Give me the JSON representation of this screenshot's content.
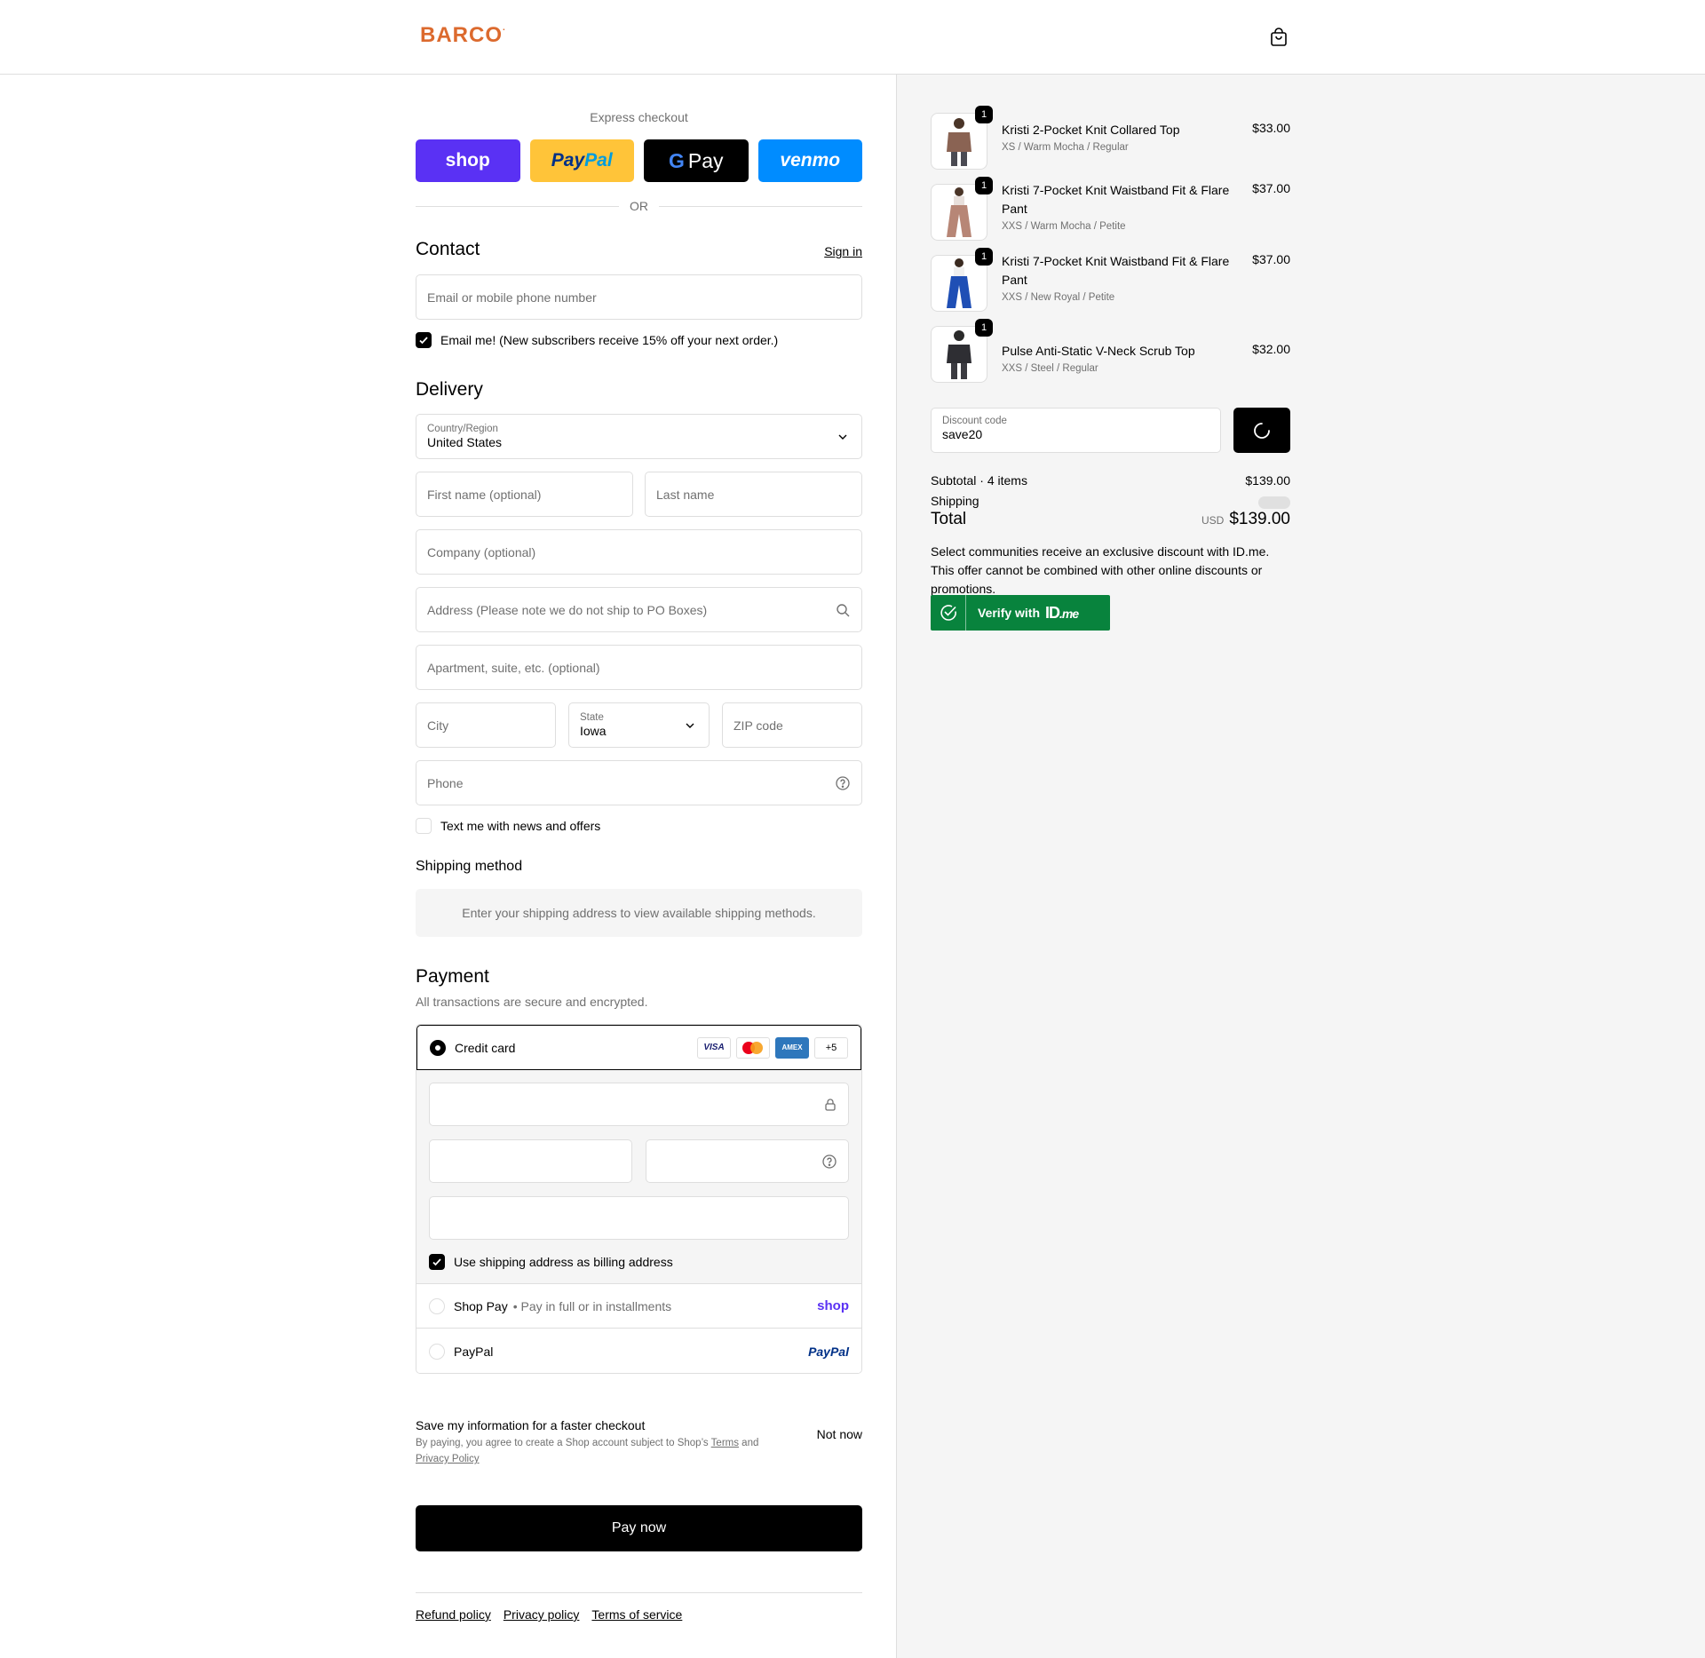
{
  "header": {
    "logo": "BARCO",
    "logo_mark": "."
  },
  "express": {
    "title": "Express checkout",
    "buttons": {
      "shop": "shop",
      "paypal_pay": "Pay",
      "paypal_pal": "Pal",
      "gpay_g": "G",
      "gpay_pay": "Pay",
      "venmo": "venmo"
    },
    "or": "OR"
  },
  "contact": {
    "heading": "Contact",
    "sign_in": "Sign in",
    "email_placeholder": "Email or mobile phone number",
    "email_me_label": "Email me! (New subscribers receive 15% off your next order.)",
    "email_me_checked": true
  },
  "delivery": {
    "heading": "Delivery",
    "country_label": "Country/Region",
    "country_value": "United States",
    "first_name_placeholder": "First name (optional)",
    "last_name_placeholder": "Last name",
    "company_placeholder": "Company (optional)",
    "address_placeholder": "Address (Please note we do not ship to PO Boxes)",
    "apartment_placeholder": "Apartment, suite, etc. (optional)",
    "city_placeholder": "City",
    "state_label": "State",
    "state_value": "Iowa",
    "zip_placeholder": "ZIP code",
    "phone_placeholder": "Phone",
    "text_me_label": "Text me with news and offers",
    "text_me_checked": false
  },
  "shipping_method": {
    "heading": "Shipping method",
    "message": "Enter your shipping address to view available shipping methods."
  },
  "payment": {
    "heading": "Payment",
    "subtitle": "All transactions are secure and encrypted.",
    "credit_card_label": "Credit card",
    "card_logos": {
      "visa": "VISA",
      "amex": "AMEX",
      "more": "+5"
    },
    "billing_same_label": "Use shipping address as billing address",
    "billing_same_checked": true,
    "shop_pay_label": "Shop Pay",
    "shop_pay_sub": "Pay in full or in installments",
    "shop_pay_brand": "shop",
    "paypal_label": "PayPal",
    "paypal_brand": "PayPal"
  },
  "save_info": {
    "title": "Save my information for a faster checkout",
    "sub_pre": "By paying, you agree to create a Shop account subject to Shop’s ",
    "terms": "Terms",
    "and": " and ",
    "privacy": "Privacy Policy",
    "not_now": "Not now"
  },
  "pay_now": "Pay now",
  "footer_links": [
    "Refund policy",
    "Privacy policy",
    "Terms of service"
  ],
  "summary": {
    "items": [
      {
        "qty": "1",
        "name": "Kristi 2-Pocket Knit Collared Top",
        "variant": "XS / Warm Mocha / Regular",
        "price": "$33.00"
      },
      {
        "qty": "1",
        "name": "Kristi 7-Pocket Knit Waistband Fit & Flare Pant",
        "variant": "XXS / Warm Mocha / Petite",
        "price": "$37.00"
      },
      {
        "qty": "1",
        "name": "Kristi 7-Pocket Knit Waistband Fit & Flare Pant",
        "variant": "XXS / New Royal / Petite",
        "price": "$37.00"
      },
      {
        "qty": "1",
        "name": "Pulse Anti-Static V-Neck Scrub Top",
        "variant": "XXS / Steel / Regular",
        "price": "$32.00"
      }
    ],
    "discount_label": "Discount code",
    "discount_value": "save20",
    "subtotal_label": "Subtotal · 4 items",
    "subtotal_value": "$139.00",
    "shipping_label": "Shipping",
    "total_label": "Total",
    "total_currency": "USD",
    "total_value": "$139.00",
    "idme_text": "Select communities receive an exclusive discount with ID.me. This offer cannot be combined with other online discounts or promotions.",
    "idme_button": {
      "verify": "Verify with",
      "id": "ID",
      "me": ".me"
    }
  },
  "colors": {
    "brand": "#dc6a2e",
    "shop_purple": "#5a31f4",
    "paypal_yellow": "#ffc439",
    "venmo_blue": "#008cff",
    "idme_green": "#08833d"
  },
  "icons": [
    "shopping-bag-icon",
    "chevron-down-icon",
    "search-icon",
    "help-circle-icon",
    "lock-icon",
    "checkmark-icon",
    "spinner-icon",
    "idme-check-icon"
  ]
}
